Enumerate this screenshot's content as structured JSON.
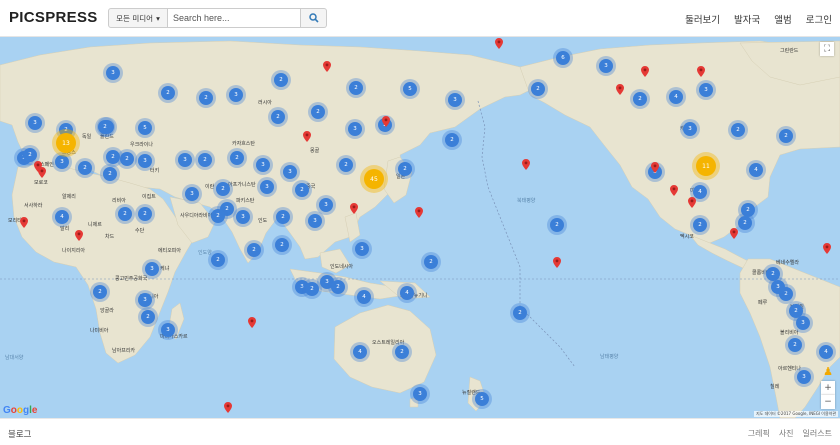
{
  "app": {
    "title": "PICSPRESS"
  },
  "search": {
    "media_filter": "모든 미디어",
    "placeholder": "Search here..."
  },
  "nav": [
    "둘러보기",
    "발자국",
    "앨범",
    "로그인"
  ],
  "map": {
    "google_logo": "Google",
    "attribution": "지도 데이터 ©2017 Google, INEGI 이용약관",
    "controls": {
      "fullscreen": "⛶",
      "zoom_in": "+",
      "zoom_out": "−",
      "pegman": "♟"
    },
    "ocean_labels": [
      "북태평양",
      "남태평양",
      "인도양",
      "남대서양"
    ],
    "country_labels": [
      "러시아",
      "카자흐스탄",
      "중국",
      "몽골",
      "인도",
      "이란",
      "사우디아라비아",
      "이집트",
      "리비아",
      "알제리",
      "말리",
      "니제르",
      "차드",
      "수단",
      "에티오피아",
      "케냐",
      "콩고민주공화국",
      "앙골라",
      "나미비아",
      "남아프리카",
      "마다가스카르",
      "오스트레일리아",
      "인도네시아",
      "미국",
      "캐나다",
      "멕시코",
      "브라질",
      "페루",
      "볼리비아",
      "아르헨티나",
      "그린란드",
      "일본",
      "파키스탄",
      "아프가니스탄",
      "터키",
      "우크라이나",
      "폴란드",
      "독일",
      "프랑스",
      "스페인",
      "모로코",
      "뉴질랜드",
      "파푸아뉴기니",
      "칠레",
      "콜롬비아",
      "베네수엘라",
      "서사하라",
      "모리타니",
      "나이지리아",
      "탄자니아"
    ],
    "cluster_counts": {
      "blue": [
        3,
        2,
        2,
        3,
        2,
        2,
        2,
        5,
        3,
        2,
        6,
        3,
        2,
        4,
        3,
        3,
        2,
        2,
        5,
        2,
        3,
        2,
        2,
        3,
        2,
        2,
        2,
        2,
        2,
        2,
        2,
        3,
        3,
        2,
        2,
        3,
        4,
        2,
        3,
        3,
        2,
        3,
        4,
        2,
        3,
        2,
        2,
        3,
        2,
        2,
        2,
        2,
        3,
        3,
        2,
        2,
        3,
        3,
        2,
        4,
        4,
        2,
        2,
        3,
        3,
        2,
        2,
        2,
        2,
        3,
        2,
        4,
        2,
        3,
        5,
        2,
        3,
        2,
        2,
        3,
        2,
        3,
        2,
        2,
        2,
        4,
        2,
        3,
        3,
        4,
        2
      ],
      "orange": [
        13,
        45,
        11
      ]
    }
  },
  "footer": {
    "left": "블로그",
    "links": [
      "그레픽",
      "사진",
      "일러스트"
    ]
  }
}
